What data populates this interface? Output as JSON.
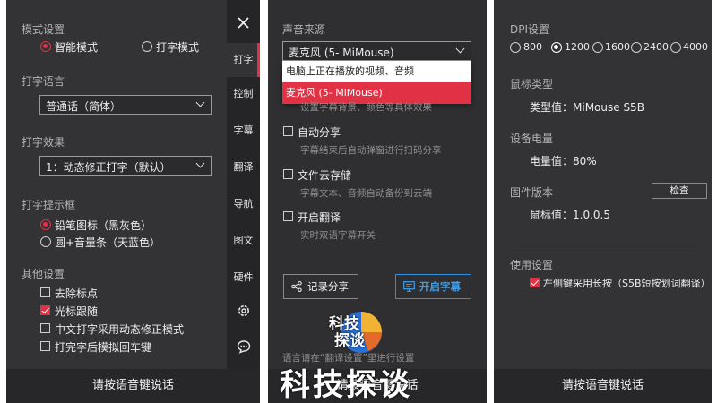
{
  "panel1": {
    "mode_title": "模式设置",
    "mode_smart": "智能模式",
    "mode_typing": "打字模式",
    "lang_title": "打字语言",
    "lang_value": "普通话（简体）",
    "effect_title": "打字效果",
    "effect_value": "1：动态修正打字（默认）",
    "hint_title": "打字提示框",
    "hint_pencil": "铅笔图标（黑灰色）",
    "hint_circle": "圆+音量条（天蓝色）",
    "other_title": "其他设置",
    "opt_remove_punct": "去除标点",
    "opt_cursor_follow": "光标跟随",
    "opt_chinese_dynamic": "中文打字采用动态修正模式",
    "opt_enter_after": "打完字后模拟回车键",
    "nav": [
      "打字",
      "控制",
      "字幕",
      "翻译",
      "导航",
      "图文",
      "硬件"
    ],
    "footer": "请按语音键说话"
  },
  "panel2": {
    "source_title": "声音来源",
    "source_value": "麦克风 (5- MiMouse)",
    "dropdown_options": [
      "电脑上正在播放的视频、音频",
      "麦克风 (5- MiMouse)"
    ],
    "subtitle_hint": "设置字幕背景、颜色等具体效果",
    "auto_share": "自动分享",
    "auto_share_desc": "字幕结束后自动弹窗进行扫码分享",
    "cloud_save": "文件云存储",
    "cloud_save_desc": "字幕文本、音频自动备份到云端",
    "translate": "开启翻译",
    "translate_desc": "实时双语字幕开关",
    "record_share_btn": "记录分享",
    "open_subtitle_btn": "开启字幕",
    "bottom_hint": "语言请在“翻译设置”里进行设置",
    "footer": "请按语音键说话"
  },
  "panel3": {
    "dpi_title": "DPI设置",
    "dpi_options": [
      "800",
      "1200",
      "1600",
      "2400",
      "4000"
    ],
    "mouse_type_title": "鼠标类型",
    "mouse_type_value": "类型值：MiMouse S5B",
    "battery_title": "设备电量",
    "battery_value": "电量值：80%",
    "firmware_title": "固件版本",
    "check_btn": "检查",
    "firmware_value": "鼠标值：1.0.0.5",
    "usage_title": "使用设置",
    "usage_opt": "左侧键采用长按（S5B短按划词翻译）",
    "footer": "请按语音键说话"
  },
  "watermark": "科技探谈",
  "logo_text": [
    "科技",
    "探谈"
  ],
  "colors": {
    "accent": "#e03145",
    "blue": "#2f8fd8",
    "panel": "#333336"
  }
}
